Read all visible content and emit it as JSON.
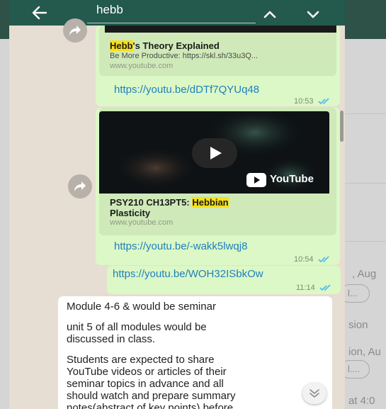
{
  "search": {
    "query": "hebb"
  },
  "background_app": {
    "frag1": ", Aug",
    "frag2": "sion",
    "frag3": "ion, Au",
    "frag4": "at 4:0",
    "pill1": "l...",
    "pill2": "l...."
  },
  "messages": {
    "card1": {
      "title_hl": "Hebb",
      "title_rest": "'s Theory Explained",
      "desc": "Be More Productive: https://skl.sh/33u3Q...",
      "site": "www.youtube.com",
      "link": "https://youtu.be/dDTf7QYUq48",
      "time": "10:53"
    },
    "card2": {
      "thumb_logo": "YouTube",
      "title_pre": "PSY210 CH13PT5: ",
      "title_hl": "Hebbian",
      "title_line2": "Plasticity",
      "site": "www.youtube.com",
      "link": "https://youtu.be/-wakk5lwqj8",
      "time": "10:54"
    },
    "msg3": {
      "link": "https://youtu.be/WOH32ISbkOw",
      "time": "11:14"
    },
    "msg4": {
      "line1": "Module 4-6 & would be seminar",
      "line2": "unit 5 of all modules would be",
      "line3": "discussed in class.",
      "line4": "Students are expected to share",
      "line5": "YouTube videos or articles of their",
      "line6": "seminar topics in advance and all",
      "line7": "should watch and prepare summary",
      "line8": "notes(abstract of key points) before"
    }
  },
  "icons": {
    "back": "arrow-left-icon",
    "prev": "chevron-up-icon",
    "next": "chevron-down-icon",
    "forward": "share-forward-icon",
    "scroll_down": "double-chevron-down-icon",
    "ticks": "double-check-icon"
  },
  "colors": {
    "toolbar": "#24594d",
    "chat_bg": "#e6ddd3",
    "outgoing": "#dcf8c6",
    "link": "#1e7fbe",
    "highlight": "#f7e01c",
    "read_ticks": "#4fb6ec"
  }
}
